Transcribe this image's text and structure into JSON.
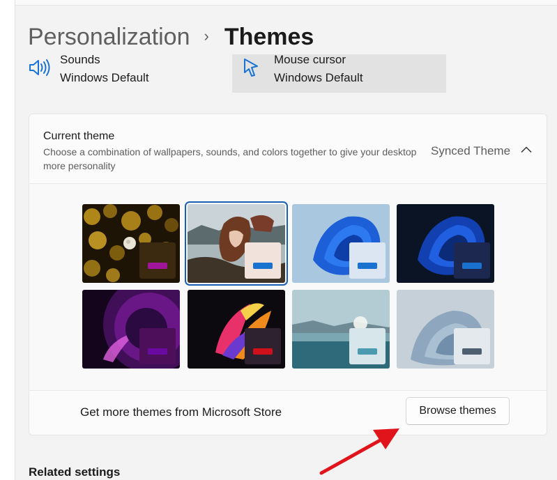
{
  "breadcrumb": {
    "parent": "Personalization",
    "separator": "›",
    "current": "Themes"
  },
  "tiles": [
    {
      "title": "Sounds",
      "value": "Windows Default",
      "icon": "speaker-icon"
    },
    {
      "title": "Mouse cursor",
      "value": "Windows Default",
      "icon": "mouse-cursor-icon"
    }
  ],
  "current_theme": {
    "title": "Current theme",
    "description": "Choose a combination of wallpapers, sounds, and colors together to give your desktop more personality",
    "value": "Synced Theme",
    "chevron": "chevron-up-icon"
  },
  "themes": [
    {
      "name": "bokeh-lights",
      "swatch_bg": "#3b2a10",
      "accent": "#a0169a",
      "selected": false
    },
    {
      "name": "woman-by-lake",
      "swatch_bg": "#f2e2dc",
      "accent": "#1a72d0",
      "selected": true
    },
    {
      "name": "windows-bloom-light",
      "swatch_bg": "#dce6f2",
      "accent": "#1a72d0",
      "selected": false
    },
    {
      "name": "windows-bloom-dark",
      "swatch_bg": "#1c2850",
      "accent": "#1a72d0",
      "selected": false
    },
    {
      "name": "glow",
      "swatch_bg": "#4e0f5a",
      "accent": "#6a0aa0",
      "selected": false
    },
    {
      "name": "captured-motion",
      "swatch_bg": "#2e2230",
      "accent": "#d0101a",
      "selected": false
    },
    {
      "name": "sunrise",
      "swatch_bg": "#d6e6ea",
      "accent": "#4a9ab0",
      "selected": false
    },
    {
      "name": "flow",
      "swatch_bg": "#e4e9ee",
      "accent": "#4e6070",
      "selected": false
    }
  ],
  "store": {
    "text": "Get more themes from Microsoft Store",
    "button_label": "Browse themes"
  },
  "related_settings": "Related settings",
  "colors": {
    "annotation_arrow": "#e0141a",
    "selection_outline": "#1a5fb4"
  }
}
